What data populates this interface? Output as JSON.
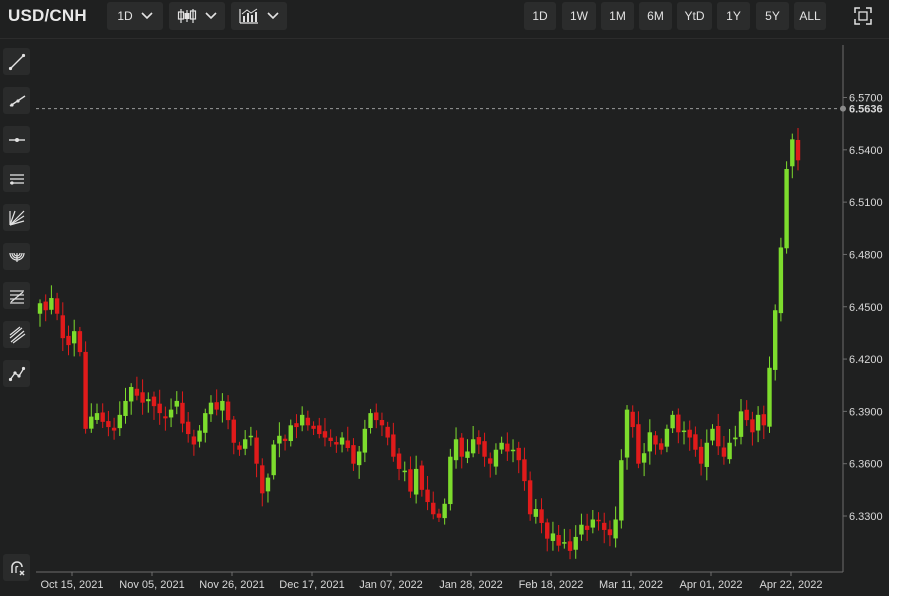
{
  "toolbar": {
    "symbol": "USD/CNH",
    "interval_label": "1D",
    "chart_style_icon": "candlestick-icon",
    "indicators_icon": "indicators-icon",
    "ranges": [
      "1D",
      "1W",
      "1M",
      "6M",
      "YtD",
      "1Y",
      "5Y",
      "ALL"
    ],
    "fullscreen_icon": "fullscreen-icon"
  },
  "tools": [
    "trend-line-icon",
    "ray-line-icon",
    "horizontal-line-icon",
    "parallel-channel-icon",
    "fan-icon",
    "arc-icon",
    "fibonacci-icon",
    "pitchfork-icon",
    "path-icon"
  ],
  "bottom_tool": "magnet-icon",
  "colors": {
    "background": "#1f2020",
    "up": "#7ddc2d",
    "down": "#e01b1b",
    "text": "#d8d8d8"
  },
  "chart_data": {
    "type": "candlestick",
    "title": "",
    "xlabel": "",
    "ylabel": "",
    "ylim": [
      6.27,
      6.585
    ],
    "yticks": [
      "6.5700",
      "6.5400",
      "6.5100",
      "6.4800",
      "6.4500",
      "6.4200",
      "6.3900",
      "6.3600",
      "6.3300"
    ],
    "xticks": [
      "Oct 15, 2021",
      "Nov 05, 2021",
      "Nov 26, 2021",
      "Dec 17, 2021",
      "Jan 07, 2022",
      "Jan 28, 2022",
      "Feb 18, 2022",
      "Mar 11, 2022",
      "Apr 01, 2022",
      "Apr 22, 2022"
    ],
    "last_price": 6.5636,
    "last_price_label": "6.5636",
    "grid": false,
    "closes": [
      6.452,
      6.448,
      6.455,
      6.446,
      6.432,
      6.428,
      6.436,
      6.424,
      6.38,
      6.387,
      6.389,
      6.384,
      6.381,
      6.379,
      6.388,
      6.396,
      6.404,
      6.399,
      6.395,
      6.397,
      6.393,
      6.389,
      6.386,
      6.391,
      6.396,
      6.383,
      6.377,
      6.371,
      6.379,
      6.389,
      6.395,
      6.391,
      6.396,
      6.385,
      6.372,
      6.368,
      6.374,
      6.376,
      6.36,
      6.343,
      6.352,
      6.371,
      6.376,
      6.373,
      6.382,
      6.381,
      6.388,
      6.382,
      6.38,
      6.377,
      6.375,
      6.373,
      6.371,
      6.375,
      6.369,
      6.36,
      6.367,
      6.38,
      6.389,
      6.385,
      6.382,
      6.375,
      6.364,
      6.357,
      6.356,
      6.344,
      6.357,
      6.345,
      6.338,
      6.331,
      6.329,
      6.337,
      6.364,
      6.374,
      6.364,
      6.367,
      6.374,
      6.371,
      6.364,
      6.36,
      6.368,
      6.372,
      6.367,
      6.368,
      6.362,
      6.35,
      6.331,
      6.334,
      6.326,
      6.317,
      6.32,
      6.313,
      6.315,
      6.31,
      6.318,
      6.325,
      6.322,
      6.328,
      6.327,
      6.322,
      6.319,
      6.328,
      6.362,
      6.391,
      6.381,
      6.36,
      6.366,
      6.378,
      6.371,
      6.368,
      6.38,
      6.388,
      6.378,
      6.379,
      6.375,
      6.368,
      6.36,
      6.372,
      6.38,
      6.37,
      6.364,
      6.372,
      6.375,
      6.39,
      6.385,
      6.378,
      6.388,
      6.382,
      6.415,
      6.448,
      6.484,
      6.529,
      6.546,
      6.534
    ]
  }
}
